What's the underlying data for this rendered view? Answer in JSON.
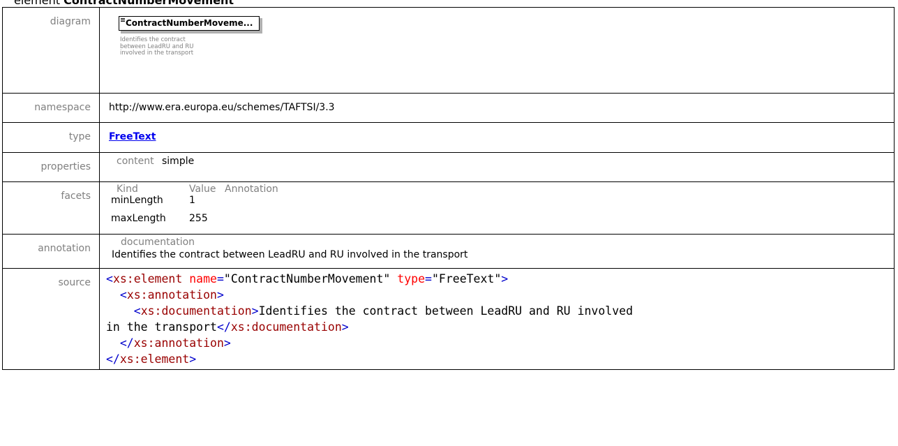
{
  "heading": {
    "prefix": "element",
    "name": "ContractNumberMovement"
  },
  "rows": {
    "diagram": {
      "label": "diagram",
      "box_title": "ContractNumberMoveme...",
      "note": "Identifies the contract between LeadRU and RU involved in the transport"
    },
    "namespace": {
      "label": "namespace",
      "value": "http://www.era.europa.eu/schemes/TAFTSI/3.3"
    },
    "type": {
      "label": "type",
      "value": "FreeText"
    },
    "properties": {
      "label": "properties",
      "key": "content",
      "value": "simple"
    },
    "facets": {
      "label": "facets",
      "headers": [
        "Kind",
        "Value",
        "Annotation"
      ],
      "items": [
        {
          "kind": "minLength",
          "value": "1"
        },
        {
          "kind": "maxLength",
          "value": "255"
        }
      ]
    },
    "annotation": {
      "label": "annotation",
      "key": "documentation",
      "value": "Identifies the contract between LeadRU and RU involved in the transport"
    },
    "source": {
      "label": "source",
      "element_open": "<xs:element",
      "attr_name": "name",
      "attr_name_value": "\"ContractNumberMovement\"",
      "attr_type": "type",
      "attr_type_value": "\"FreeText\"",
      "close_gt": ">",
      "annotation_open": "<xs:annotation>",
      "doc_open": "<xs:documentation>",
      "doc_text_1": "Identifies the contract between LeadRU and RU involved",
      "doc_text_2": "in the transport",
      "doc_close": "</xs:documentation>",
      "annotation_close": "</xs:annotation>",
      "element_close": "</xs:element>"
    }
  },
  "colors": {
    "label_gray": "#808080",
    "link_blue": "#0000ee",
    "xml_tag_blue": "#0000cc",
    "xml_tagname_red": "#990000",
    "xml_attr_red": "#ff0000"
  }
}
